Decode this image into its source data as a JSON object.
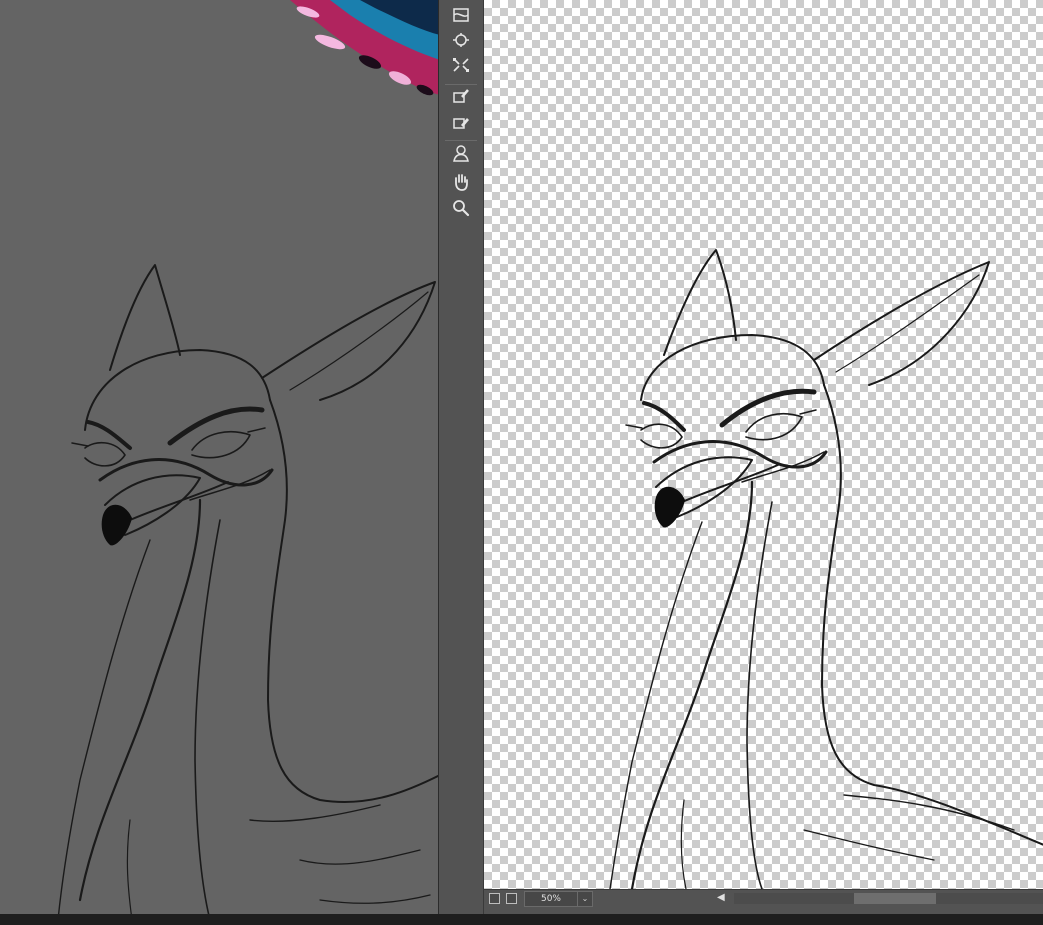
{
  "toolbar": {
    "tools": [
      {
        "name": "warp-tool",
        "icon": "warp-icon"
      },
      {
        "name": "reconstruct-tool",
        "icon": "reconstruct-icon"
      },
      {
        "name": "pucker-tool",
        "icon": "pucker-icon"
      },
      {
        "name": "freeze-mask-tool",
        "icon": "freeze-mask-icon"
      },
      {
        "name": "thaw-mask-tool",
        "icon": "thaw-mask-icon"
      },
      {
        "name": "face-tool",
        "icon": "face-icon"
      },
      {
        "name": "hand-tool",
        "icon": "hand-icon"
      },
      {
        "name": "zoom-tool",
        "icon": "zoom-icon"
      }
    ]
  },
  "statusbar": {
    "zoom_value": "50%",
    "zoom_dropdown": "⌄",
    "scroll_left": "◀"
  },
  "colors": {
    "workspace": "#646464",
    "panel": "#535353",
    "sketch_stroke": "#1a1a1a"
  }
}
